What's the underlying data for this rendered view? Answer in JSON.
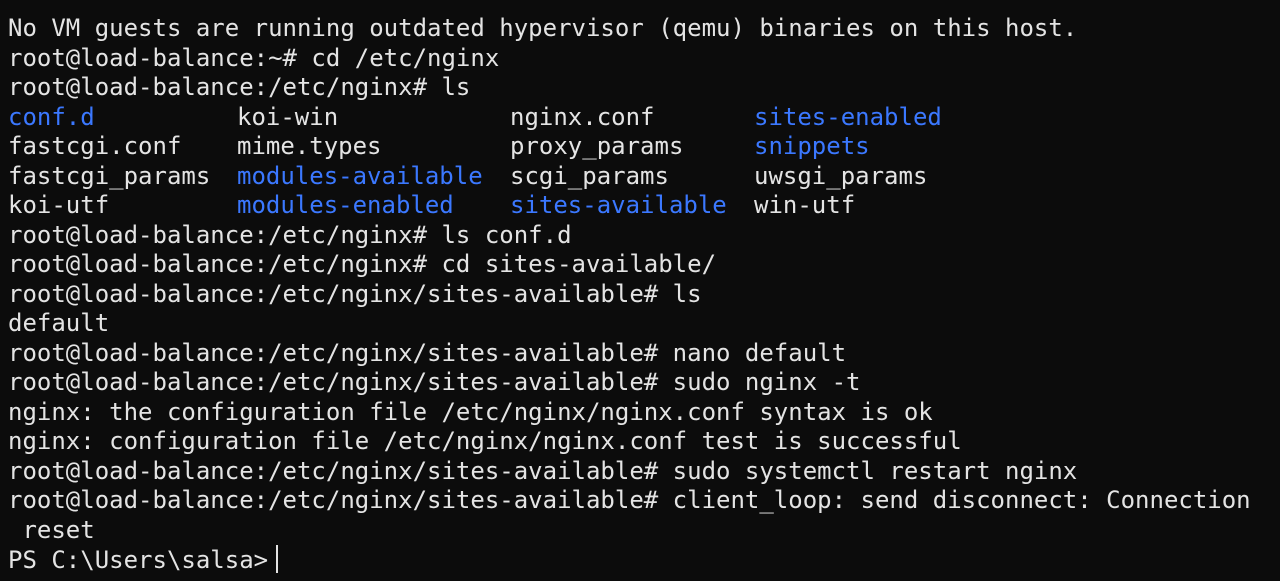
{
  "colors": {
    "background": "#0c0c0c",
    "text": "#e4e4e4",
    "directory": "#3b78ff"
  },
  "terminal": {
    "line_01": "No VM guests are running outdated hypervisor (qemu) binaries on this host.",
    "line_02": "root@load-balance:~# cd /etc/nginx",
    "line_03": "root@load-balance:/etc/nginx# ls",
    "ls_listing": [
      [
        {
          "name": "conf.d",
          "dir": true
        },
        {
          "name": "koi-win",
          "dir": false
        },
        {
          "name": "nginx.conf",
          "dir": false
        },
        {
          "name": "sites-enabled",
          "dir": true
        }
      ],
      [
        {
          "name": "fastcgi.conf",
          "dir": false
        },
        {
          "name": "mime.types",
          "dir": false
        },
        {
          "name": "proxy_params",
          "dir": false
        },
        {
          "name": "snippets",
          "dir": true
        }
      ],
      [
        {
          "name": "fastcgi_params",
          "dir": false
        },
        {
          "name": "modules-available",
          "dir": true
        },
        {
          "name": "scgi_params",
          "dir": false
        },
        {
          "name": "uwsgi_params",
          "dir": false
        }
      ],
      [
        {
          "name": "koi-utf",
          "dir": false
        },
        {
          "name": "modules-enabled",
          "dir": true
        },
        {
          "name": "sites-available",
          "dir": true
        },
        {
          "name": "win-utf",
          "dir": false
        }
      ]
    ],
    "line_08": "root@load-balance:/etc/nginx# ls conf.d",
    "line_09": "root@load-balance:/etc/nginx# cd sites-available/",
    "line_10": "root@load-balance:/etc/nginx/sites-available# ls",
    "line_11": "default",
    "line_12": "root@load-balance:/etc/nginx/sites-available# nano default",
    "line_13": "root@load-balance:/etc/nginx/sites-available# sudo nginx -t",
    "line_14": "nginx: the configuration file /etc/nginx/nginx.conf syntax is ok",
    "line_15": "nginx: configuration file /etc/nginx/nginx.conf test is successful",
    "line_16": "root@load-balance:/etc/nginx/sites-available# sudo systemctl restart nginx",
    "line_17": "root@load-balance:/etc/nginx/sites-available# client_loop: send disconnect: Connection",
    "line_18": " reset",
    "prompt": "PS C:\\Users\\salsa>"
  }
}
